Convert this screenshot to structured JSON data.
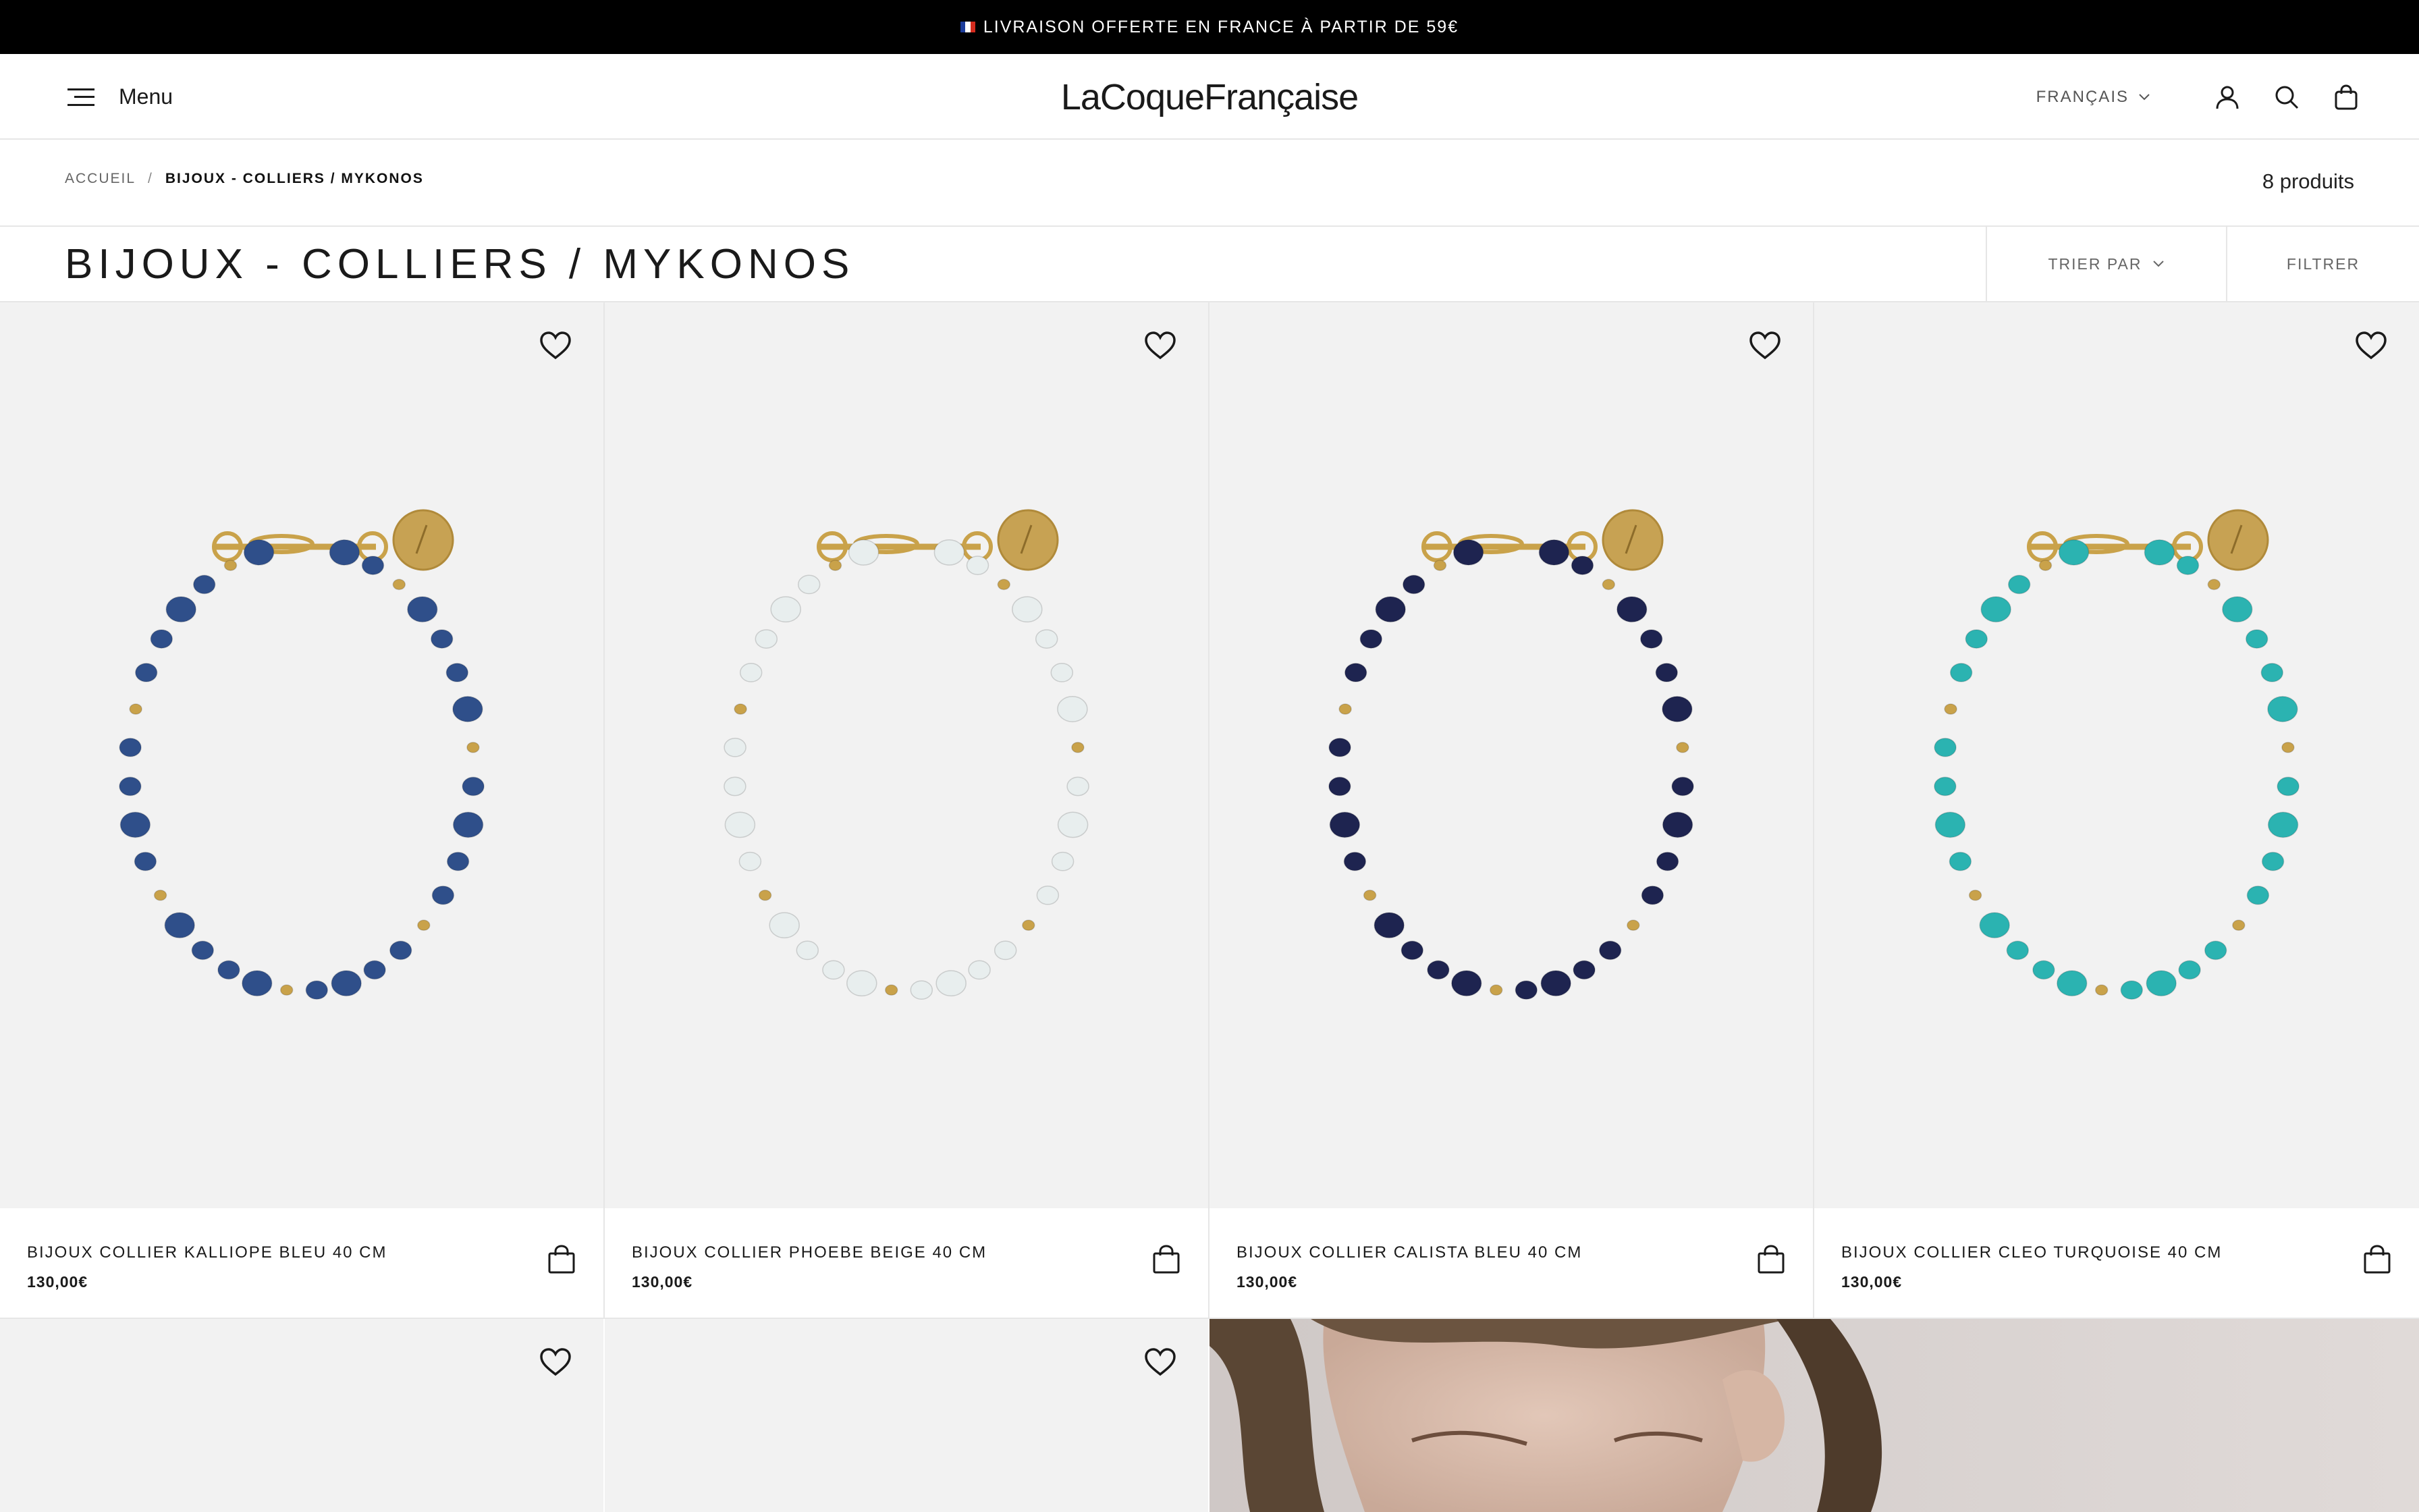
{
  "announcement": {
    "flag_icon": "france-flag-icon",
    "text": "LIVRAISON OFFERTE EN FRANCE À PARTIR DE 59€"
  },
  "header": {
    "menu_label": "Menu",
    "logo": "LaCoqueFrançaise",
    "language": "FRANÇAIS",
    "icons": [
      "account-icon",
      "search-icon",
      "cart-icon"
    ]
  },
  "breadcrumb": {
    "home": "ACCUEIL",
    "separator": "/",
    "current": "BIJOUX - COLLIERS / MYKONOS"
  },
  "collection": {
    "product_count": "8 produits",
    "title": "BIJOUX - COLLIERS / MYKONOS",
    "sort_label": "TRIER PAR",
    "filter_label": "FILTRER"
  },
  "products": [
    {
      "name": "BIJOUX COLLIER KALLIOPE BLEU 40 CM",
      "price": "130,00€",
      "bead_color": "#2f4f8a"
    },
    {
      "name": "BIJOUX COLLIER PHOEBE BEIGE 40 CM",
      "price": "130,00€",
      "bead_color": "#e8eeee"
    },
    {
      "name": "BIJOUX COLLIER CALISTA BLEU 40 CM",
      "price": "130,00€",
      "bead_color": "#1e2450"
    },
    {
      "name": "BIJOUX COLLIER CLEO TURQUOISE 40 CM",
      "price": "130,00€",
      "bead_color": "#2bb3b1"
    }
  ],
  "colors": {
    "announcement_bg": "#000000",
    "card_bg": "#f2f2f2",
    "divider": "#e6e6e6",
    "gold": "#c9a24a"
  }
}
